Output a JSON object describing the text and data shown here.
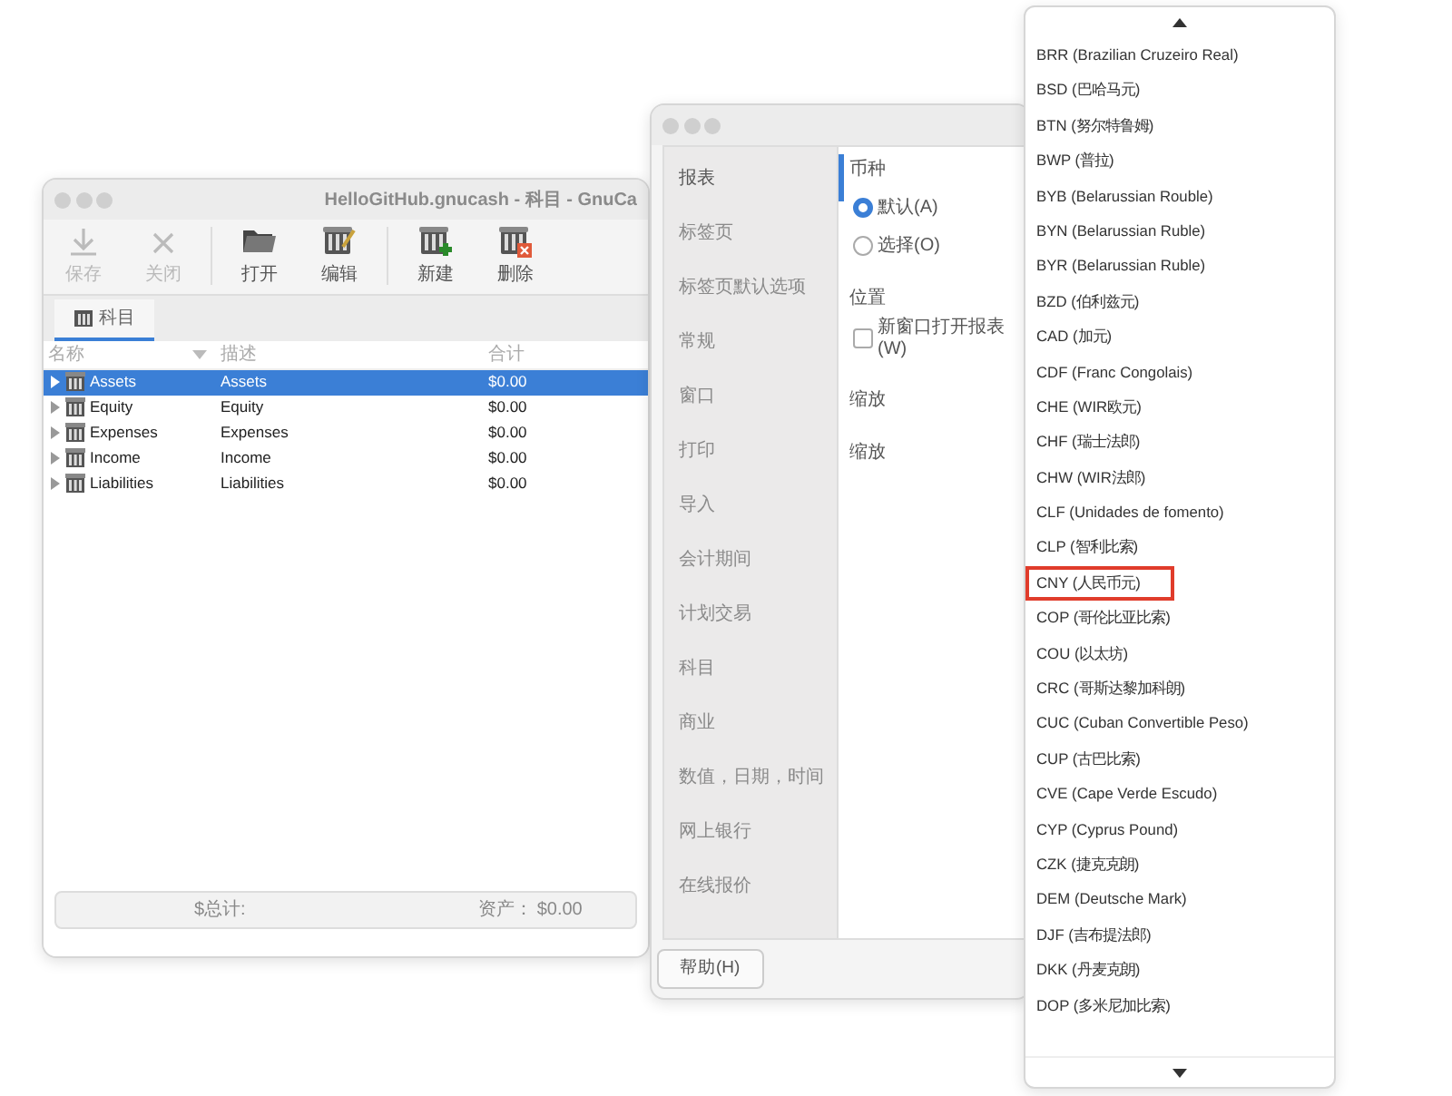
{
  "main_window": {
    "title": "HelloGitHub.gnucash - 科目 - GnuCa",
    "toolbar": [
      {
        "kind": "save",
        "label": "保存",
        "disabled": true
      },
      {
        "kind": "close",
        "label": "关闭",
        "disabled": true
      },
      {
        "kind": "open",
        "label": "打开",
        "disabled": false
      },
      {
        "kind": "edit",
        "label": "编辑",
        "disabled": false
      },
      {
        "kind": "new",
        "label": "新建",
        "disabled": false
      },
      {
        "kind": "delete",
        "label": "删除",
        "disabled": false
      }
    ],
    "tabs": [
      {
        "label": "科目",
        "selected": true
      }
    ],
    "columns": [
      "名称",
      "描述",
      "合计"
    ],
    "accounts": [
      {
        "name": "Assets",
        "description": "Assets",
        "total": "$0.00",
        "selected": true,
        "expanded": false
      },
      {
        "name": "Equity",
        "description": "Equity",
        "total": "$0.00",
        "selected": false,
        "expanded": false
      },
      {
        "name": "Expenses",
        "description": "Expenses",
        "total": "$0.00",
        "selected": false,
        "expanded": false
      },
      {
        "name": "Income",
        "description": "Income",
        "total": "$0.00",
        "selected": false,
        "expanded": false
      },
      {
        "name": "Liabilities",
        "description": "Liabilities",
        "total": "$0.00",
        "selected": false,
        "expanded": false
      }
    ],
    "footer": {
      "total_label": "$总计:",
      "assets_label": "资产：",
      "assets_value": "$0.00"
    }
  },
  "preferences": {
    "sidebar": [
      {
        "label": "报表",
        "selected": true
      },
      {
        "label": "标签页",
        "selected": false
      },
      {
        "label": "标签页默认选项",
        "selected": false
      },
      {
        "label": "常规",
        "selected": false
      },
      {
        "label": "窗口",
        "selected": false
      },
      {
        "label": "打印",
        "selected": false
      },
      {
        "label": "导入",
        "selected": false
      },
      {
        "label": "会计期间",
        "selected": false
      },
      {
        "label": "计划交易",
        "selected": false
      },
      {
        "label": "科目",
        "selected": false
      },
      {
        "label": "商业",
        "selected": false
      },
      {
        "label": "数值，日期，时间",
        "selected": false
      },
      {
        "label": "网上银行",
        "selected": false
      },
      {
        "label": "在线报价",
        "selected": false
      }
    ],
    "options": [
      {
        "kind": "heading",
        "label": "币种"
      },
      {
        "kind": "radio",
        "label": "默认(A)",
        "selected": true
      },
      {
        "kind": "radio",
        "label": "选择(O)",
        "selected": false
      },
      {
        "kind": "heading",
        "label": "位置"
      },
      {
        "kind": "checkbox",
        "label": "新窗口打开报表(W)",
        "checked": false
      },
      {
        "kind": "heading",
        "label": "缩放"
      },
      {
        "kind": "heading",
        "label": "缩放"
      }
    ],
    "help_button": "帮助(H)"
  },
  "currency_dropdown": {
    "items": [
      {
        "label": "BRR (Brazilian Cruzeiro Real)",
        "highlighted": false
      },
      {
        "label": "BSD (巴哈马元)",
        "highlighted": false
      },
      {
        "label": "BTN (努尔特鲁姆)",
        "highlighted": false
      },
      {
        "label": "BWP (普拉)",
        "highlighted": false
      },
      {
        "label": "BYB (Belarussian Rouble)",
        "highlighted": false
      },
      {
        "label": "BYN (Belarussian Ruble)",
        "highlighted": false
      },
      {
        "label": "BYR (Belarussian Ruble)",
        "highlighted": false
      },
      {
        "label": "BZD (伯利兹元)",
        "highlighted": false
      },
      {
        "label": "CAD (加元)",
        "highlighted": false
      },
      {
        "label": "CDF (Franc Congolais)",
        "highlighted": false
      },
      {
        "label": "CHE (WIR欧元)",
        "highlighted": false
      },
      {
        "label": "CHF (瑞士法郎)",
        "highlighted": false
      },
      {
        "label": "CHW (WIR法郎)",
        "highlighted": false
      },
      {
        "label": "CLF (Unidades de fomento)",
        "highlighted": false
      },
      {
        "label": "CLP (智利比索)",
        "highlighted": false
      },
      {
        "label": "CNY (人民币元)",
        "highlighted": true
      },
      {
        "label": "COP (哥伦比亚比索)",
        "highlighted": false
      },
      {
        "label": "COU (以太坊)",
        "highlighted": false
      },
      {
        "label": "CRC (哥斯达黎加科朗)",
        "highlighted": false
      },
      {
        "label": "CUC (Cuban Convertible Peso)",
        "highlighted": false
      },
      {
        "label": "CUP (古巴比索)",
        "highlighted": false
      },
      {
        "label": "CVE (Cape Verde Escudo)",
        "highlighted": false
      },
      {
        "label": "CYP (Cyprus Pound)",
        "highlighted": false
      },
      {
        "label": "CZK (捷克克朗)",
        "highlighted": false
      },
      {
        "label": "DEM (Deutsche Mark)",
        "highlighted": false
      },
      {
        "label": "DJF (吉布提法郎)",
        "highlighted": false
      },
      {
        "label": "DKK (丹麦克朗)",
        "highlighted": false
      },
      {
        "label": "DOP (多米尼加比索)",
        "highlighted": false
      }
    ]
  }
}
